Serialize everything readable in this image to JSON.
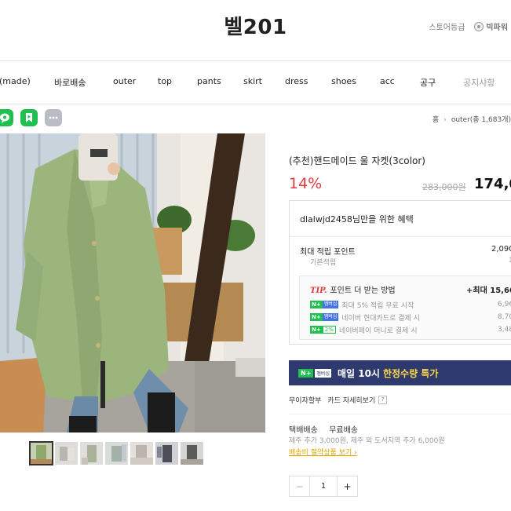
{
  "header": {
    "brand": "벨201",
    "store_grade_label": "스토어등급",
    "grade_name": "빅파워"
  },
  "nav": {
    "items": [
      {
        "label": "(made)",
        "dim": false
      },
      {
        "label": "바로배송",
        "dim": false
      },
      {
        "label": "outer",
        "dim": false
      },
      {
        "label": "top",
        "dim": false
      },
      {
        "label": "pants",
        "dim": false
      },
      {
        "label": "skirt",
        "dim": false
      },
      {
        "label": "dress",
        "dim": false
      },
      {
        "label": "shoes",
        "dim": false
      },
      {
        "label": "acc",
        "dim": false
      },
      {
        "label": "공구",
        "dim": false
      },
      {
        "label": "공지사항",
        "dim": true
      }
    ]
  },
  "share": {
    "buttons": [
      {
        "icon": "talk-share-icon",
        "color": "#1fbf50"
      },
      {
        "icon": "bookmark-share-icon",
        "color": "#1fbf50"
      },
      {
        "icon": "more-icon",
        "color": "#b9bcc5"
      }
    ]
  },
  "breadcrumb": {
    "home": "홈",
    "arrow": "›",
    "current": "outer(총 1,683개)"
  },
  "product": {
    "title": "(추천)핸드메이드 울 자켓(3color)",
    "discount": "14%",
    "original_price": "283,000원",
    "price": "174,0",
    "thumb_count": 7
  },
  "benefits": {
    "title": "dlalwjd2458님만을 위한 혜택",
    "max_points_label": "최대 적립 포인트",
    "max_points_value": "2,090",
    "basic_label": "기본적립",
    "basic_value": "1",
    "tip_label": "TIP.",
    "tip_text": "포인트 더 받는 방법",
    "tip_max": "+최대 15,660",
    "n_badge": "N+",
    "membership_badge": "멤버십",
    "rows": [
      {
        "text": "최대 5% 적립 무료 시작",
        "value": "6,96",
        "badge": "membership"
      },
      {
        "text": "네이버 현대카드로 결제 시",
        "value": "8,70",
        "badge": "membership"
      },
      {
        "text": "네이버페이 머니로 결제 시",
        "value": "3,48",
        "badge": "pct",
        "pct": "2%"
      }
    ]
  },
  "promo": {
    "n_badge": "N+",
    "membership": "멤버십",
    "text1": "매일 10시",
    "text2": "한정수량 특가"
  },
  "installment": {
    "label1": "무이자할부",
    "label2": "카드 자세히보기",
    "q": "?"
  },
  "shipping": {
    "type": "택배배송",
    "fee": "무료배송",
    "extra": "제주 추가 3,000원, 제주 외 도서지역 추가 6,000원",
    "bundle_link": "배송비 절약상품 보기 ›"
  },
  "quantity": {
    "minus": "−",
    "value": "1",
    "plus": "+"
  }
}
